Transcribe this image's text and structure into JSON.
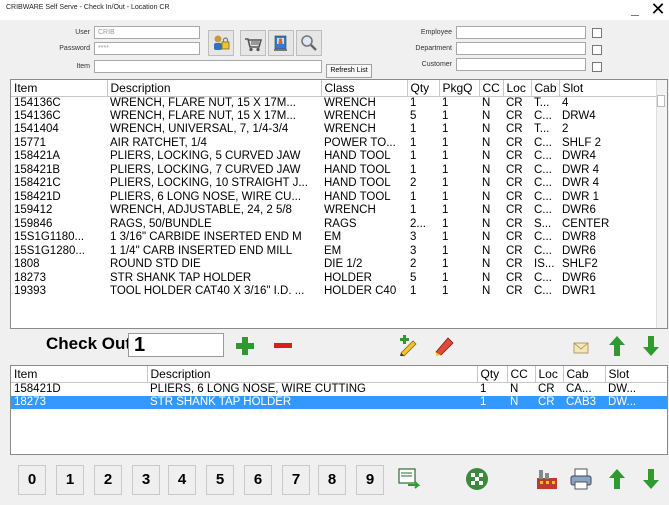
{
  "window": {
    "title": "CRIBWARE Self Serve - Check In/Out - Location CR",
    "minimize": "_",
    "close": "✕"
  },
  "login": {
    "user_label": "User",
    "user_value": "CRIB",
    "password_label": "Password",
    "password_value": "****",
    "item_label": "Item",
    "item_value": ""
  },
  "filters": {
    "employee_label": "Employee",
    "department_label": "Department",
    "customer_label": "Customer",
    "refresh_label": "Refresh List"
  },
  "items_table": {
    "columns": [
      "Item",
      "Description",
      "Class",
      "Qty",
      "PkgQ",
      "CC",
      "Loc",
      "Cab",
      "Slot"
    ],
    "rows": [
      [
        "154136C",
        "WRENCH, FLARE NUT, 15 X 17M...",
        "WRENCH",
        "1",
        "1",
        "N",
        "CR",
        "T...",
        "4"
      ],
      [
        "154136C",
        "WRENCH, FLARE NUT, 15 X 17M...",
        "WRENCH",
        "5",
        "1",
        "N",
        "CR",
        "C...",
        "DRW4"
      ],
      [
        "1541404",
        "WRENCH, UNIVERSAL, 7, 1/4-3/4",
        "WRENCH",
        "1",
        "1",
        "N",
        "CR",
        "T...",
        "2"
      ],
      [
        "15771",
        "AIR RATCHET, 1/4",
        "POWER TO...",
        "1",
        "1",
        "N",
        "CR",
        "C...",
        "SHLF 2"
      ],
      [
        "158421A",
        "PLIERS, LOCKING, 5 CURVED JAW",
        "HAND TOOL",
        "1",
        "1",
        "N",
        "CR",
        "C...",
        "DWR4"
      ],
      [
        "158421B",
        "PLIERS, LOCKING, 7 CURVED JAW",
        "HAND TOOL",
        "1",
        "1",
        "N",
        "CR",
        "C...",
        "DWR 4"
      ],
      [
        "158421C",
        "PLIERS, LOCKING, 10 STRAIGHT J...",
        "HAND TOOL",
        "2",
        "1",
        "N",
        "CR",
        "C...",
        "DWR 4"
      ],
      [
        "158421D",
        "PLIERS, 6 LONG NOSE, WIRE CU...",
        "HAND TOOL",
        "1",
        "1",
        "N",
        "CR",
        "C...",
        "DWR 1"
      ],
      [
        "159412",
        "WRENCH, ADJUSTABLE, 24, 2 5/8",
        "WRENCH",
        "1",
        "1",
        "N",
        "CR",
        "C...",
        "DWR6"
      ],
      [
        "159846",
        "RAGS, 50/BUNDLE",
        "RAGS",
        "2...",
        "1",
        "N",
        "CR",
        "S...",
        "CENTER"
      ],
      [
        "15S1G1180...",
        "1 3/16\" CARBIDE INSERTED END M",
        "EM",
        "3",
        "1",
        "N",
        "CR",
        "C...",
        "DWR8"
      ],
      [
        "15S1G1280...",
        "1 1/4\" CARB INSERTED END MILL",
        "EM",
        "3",
        "1",
        "N",
        "CR",
        "C...",
        "DWR6"
      ],
      [
        "1808",
        "ROUND STD DIE",
        "DIE 1/2",
        "2",
        "1",
        "N",
        "CR",
        "IS...",
        "SHLF2"
      ],
      [
        "18273",
        "STR SHANK TAP HOLDER",
        "HOLDER",
        "5",
        "1",
        "N",
        "CR",
        "C...",
        "DWR6"
      ],
      [
        "19393",
        "TOOL HOLDER CAT40 X 3/16\" I.D. ...",
        "HOLDER C40",
        "1",
        "1",
        "N",
        "CR",
        "C...",
        "DWR1"
      ]
    ]
  },
  "checkout": {
    "label": "Check Out",
    "quantity": "1"
  },
  "cart_table": {
    "columns": [
      "Item",
      "Description",
      "Qty",
      "CC",
      "Loc",
      "Cab",
      "Slot"
    ],
    "rows": [
      [
        "158421D",
        "PLIERS, 6 LONG NOSE, WIRE CUTTING",
        "1",
        "N",
        "CR",
        "CA...",
        "DW..."
      ],
      [
        "18273",
        "STR SHANK TAP HOLDER",
        "1",
        "N",
        "CR",
        "CAB3",
        "DW..."
      ]
    ],
    "selected_row": 1
  },
  "numpad": [
    "0",
    "1",
    "2",
    "3",
    "4",
    "5",
    "6",
    "7",
    "8",
    "9"
  ],
  "colors": {
    "selection": "#3399ff",
    "plus_green": "#2e9a2e",
    "minus_red": "#d62020",
    "arrow_green": "#2f9a2f"
  },
  "icons": [
    "lock-user-icon",
    "cart-icon",
    "computer-person-icon",
    "search-icon",
    "add-icon",
    "remove-icon",
    "pencil-add-icon",
    "pencil-remove-icon",
    "envelope-icon",
    "up-arrow-icon",
    "down-arrow-icon",
    "checkout-icon",
    "checkered-flag-icon",
    "factory-icon",
    "printer-icon"
  ]
}
